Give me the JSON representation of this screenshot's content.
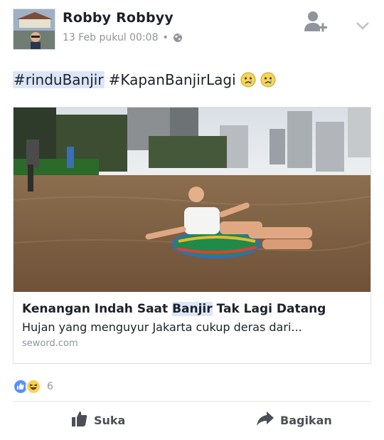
{
  "post": {
    "author": "Robby Robbyy",
    "timestamp": "13 Feb pukul 00:08",
    "separator": "•",
    "privacy_icon": "globe-icon",
    "text_tags": [
      "#rinduBanjir",
      "#KapanBanjirLagi"
    ],
    "text_emojis": [
      "crying-face",
      "crying-face"
    ]
  },
  "link": {
    "title_before": "Kenangan Indah Saat ",
    "title_highlight": "Banjir",
    "title_after": " Tak Lagi Datang",
    "description": "Hujan yang menguyur Jakarta cukup deras dari...",
    "domain": "seword.com"
  },
  "reactions": {
    "icons": [
      "like",
      "haha"
    ],
    "count": "6"
  },
  "actions": {
    "like_label": "Suka",
    "share_label": "Bagikan"
  },
  "colors": {
    "facebook_blue": "#4267b2",
    "hashtag_highlight": "#dbe6f9",
    "muted_text": "#90949c"
  }
}
